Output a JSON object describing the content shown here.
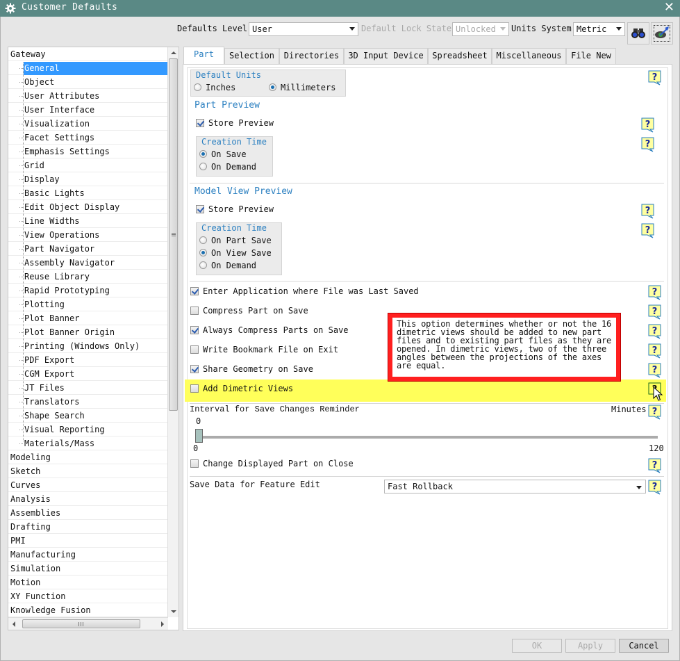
{
  "window": {
    "title": "Customer Defaults",
    "close_icon": "close-icon"
  },
  "toolbar": {
    "defaults_level_label": "Defaults Level",
    "defaults_level_value": "User",
    "lock_state_label": "Default Lock State",
    "lock_state_value": "Unlocked",
    "units_system_label": "Units System",
    "units_system_value": "Metric",
    "find_button_icon": "binoculars-icon",
    "view_changes_button_icon": "eye-arrow-icon"
  },
  "tree": {
    "root": "Gateway",
    "children": [
      "General",
      "Object",
      "User Attributes",
      "User Interface",
      "Visualization",
      "Facet Settings",
      "Emphasis Settings",
      "Grid",
      "Display",
      "Basic Lights",
      "Edit Object Display",
      "Line Widths",
      "View Operations",
      "Part Navigator",
      "Assembly Navigator",
      "Reuse Library",
      "Rapid Prototyping",
      "Plotting",
      "Plot Banner",
      "Plot Banner Origin",
      "Printing (Windows Only)",
      "PDF Export",
      "CGM Export",
      "JT Files",
      "Translators",
      "Shape Search",
      "Visual Reporting",
      "Materials/Mass"
    ],
    "selected": "General",
    "other_roots": [
      "Modeling",
      "Sketch",
      "Curves",
      "Analysis",
      "Assemblies",
      "Drafting",
      "PMI",
      "Manufacturing",
      "Simulation",
      "Motion",
      "XY Function",
      "Knowledge Fusion"
    ]
  },
  "tabs": [
    {
      "label": "Part",
      "active": true
    },
    {
      "label": "Selection",
      "active": false
    },
    {
      "label": "Directories",
      "active": false
    },
    {
      "label": "3D Input Device",
      "active": false
    },
    {
      "label": "Spreadsheet",
      "active": false
    },
    {
      "label": "Miscellaneous",
      "active": false
    },
    {
      "label": "File New",
      "active": false
    }
  ],
  "part": {
    "default_units": {
      "title": "Default Units",
      "options": [
        "Inches",
        "Millimeters"
      ],
      "selected": "Millimeters"
    },
    "part_preview": {
      "title": "Part Preview",
      "store_preview_label": "Store Preview",
      "store_preview_checked": true,
      "creation_time_title": "Creation Time",
      "creation_time_options": [
        "On Save",
        "On Demand"
      ],
      "creation_time_selected": "On Save"
    },
    "model_view_preview": {
      "title": "Model View Preview",
      "store_preview_label": "Store Preview",
      "store_preview_checked": true,
      "creation_time_title": "Creation Time",
      "creation_time_options": [
        "On Part Save",
        "On View Save",
        "On Demand"
      ],
      "creation_time_selected": "On View Save"
    },
    "options": [
      {
        "label": "Enter Application where File was Last Saved",
        "checked": true
      },
      {
        "label": "Compress Part on Save",
        "checked": false
      },
      {
        "label": "Always Compress Parts on Save",
        "checked": true
      },
      {
        "label": "Write Bookmark File on Exit",
        "checked": false
      },
      {
        "label": "Share Geometry on Save",
        "checked": true
      },
      {
        "label": "Add Dimetric Views",
        "checked": false
      }
    ],
    "interval": {
      "label": "Interval for Save Changes Reminder",
      "units": "Minutes",
      "value": "0",
      "min": "0",
      "max": "120"
    },
    "change_displayed_part": {
      "label": "Change Displayed Part on Close",
      "checked": false
    },
    "save_data": {
      "label": "Save Data for Feature Edit",
      "value": "Fast Rollback"
    }
  },
  "tooltip": {
    "text": "This option determines whether or not the 16\ndimetric views should be added to new part\nfiles and to existing part files as they are\nopened. In dimetric views, two of the three\nangles between the projections of the axes\nare equal.",
    "border_color": "#ff1f1f",
    "highlight_color": "#ffff5a"
  },
  "buttons": {
    "ok": "OK",
    "apply": "Apply",
    "cancel": "Cancel"
  },
  "colors": {
    "titlebar": "#5a8985",
    "accent": "#2a7fc0",
    "selection": "#3399ff"
  }
}
